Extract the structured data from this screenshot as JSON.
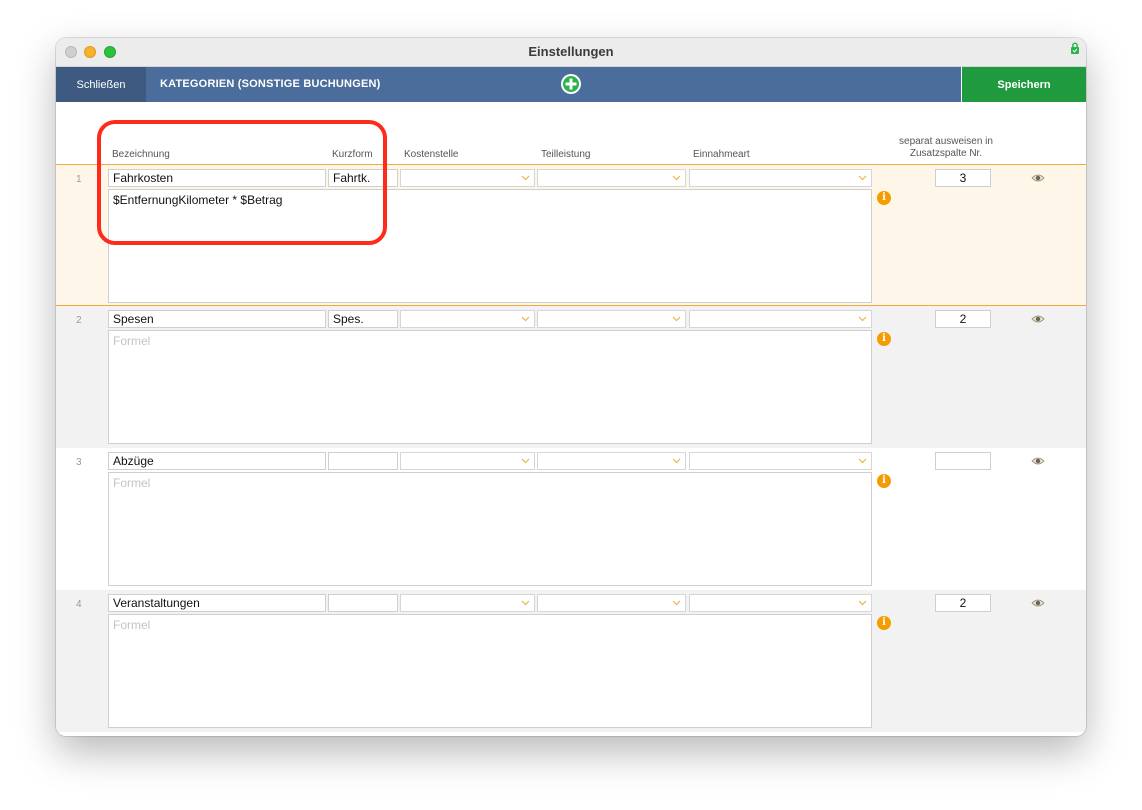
{
  "window": {
    "title": "Einstellungen"
  },
  "toolbar": {
    "close_label": "Schließen",
    "section_title": "KATEGORIEN (SONSTIGE BUCHUNGEN)",
    "save_label": "Speichern"
  },
  "columns": {
    "bezeichnung": "Bezeichnung",
    "kurzform": "Kurzform",
    "kostenstelle": "Kostenstelle",
    "teilleistung": "Teilleistung",
    "einnahmeart": "Einnahmeart",
    "separat_line1": "separat ausweisen in",
    "separat_line2": "Zusatzspalte Nr."
  },
  "rows": [
    {
      "num": "1",
      "bezeichnung": "Fahrkosten",
      "kurzform": "Fahrtk.",
      "formel": "$EntfernungKilometer * $Betrag",
      "formel_placeholder": "",
      "spalte": "3"
    },
    {
      "num": "2",
      "bezeichnung": "Spesen",
      "kurzform": "Spes.",
      "formel": "",
      "formel_placeholder": "Formel",
      "spalte": "2"
    },
    {
      "num": "3",
      "bezeichnung": "Abzüge",
      "kurzform": "",
      "formel": "",
      "formel_placeholder": "Formel",
      "spalte": ""
    },
    {
      "num": "4",
      "bezeichnung": "Veranstaltungen",
      "kurzform": "",
      "formel": "",
      "formel_placeholder": "Formel",
      "spalte": "2"
    }
  ],
  "icons": {
    "info": "i",
    "eye": "eye-icon",
    "add": "plus-circle-icon",
    "lock": "lock-icon",
    "chevron": "chevron-down-icon"
  },
  "colors": {
    "toolbar": "#4b6d9b",
    "save": "#1f9a3f",
    "accent_orange": "#f59c00",
    "highlight": "#ff2b1a"
  }
}
